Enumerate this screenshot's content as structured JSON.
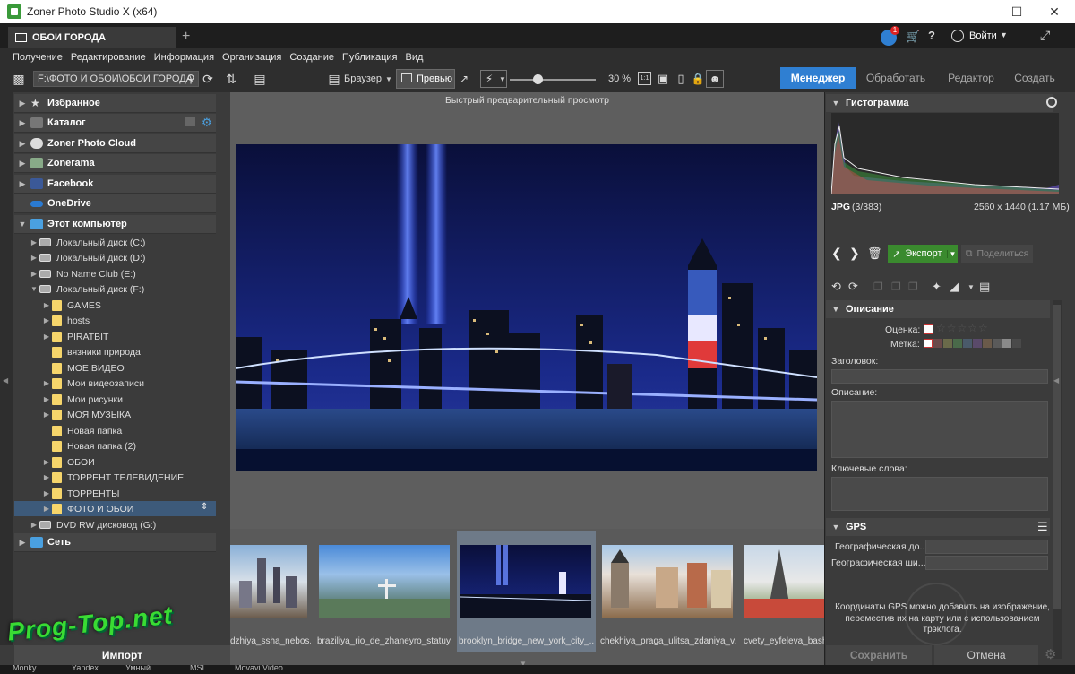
{
  "window": {
    "title": "Zoner Photo Studio X (x64)"
  },
  "tab": {
    "label": "ОБОИ ГОРОДА",
    "add": "+"
  },
  "header": {
    "login": "Войти",
    "notification_count": "1"
  },
  "menu": [
    "Получение",
    "Редактирование",
    "Информация",
    "Организация",
    "Создание",
    "Публикация",
    "Вид"
  ],
  "toolbar": {
    "path": "F:\\ФОТО И ОБОИ\\ОБОИ ГОРОДА",
    "browser_label": "Браузер",
    "preview_label": "Превью",
    "zoom": "30 %",
    "zoom_fraction": 0.32,
    "one_to_one": "1:1",
    "modes": [
      "Менеджер",
      "Обработать",
      "Редактор",
      "Создать"
    ],
    "active_mode": "Менеджер"
  },
  "tree": {
    "top": [
      {
        "label": "Избранное",
        "icon": "star-icon"
      },
      {
        "label": "Каталог",
        "icon": "catalog-icon"
      },
      {
        "label": "Zoner Photo Cloud",
        "icon": "cloud-icon"
      },
      {
        "label": "Zonerama",
        "icon": "zonerama-icon"
      },
      {
        "label": "Facebook",
        "icon": "facebook-icon"
      },
      {
        "label": "OneDrive",
        "icon": "onedrive-icon"
      },
      {
        "label": "Этот компьютер",
        "icon": "computer-icon"
      }
    ],
    "drives": [
      "Локальный диск (C:)",
      "Локальный диск (D:)",
      "No Name Club (E:)",
      "Локальный диск (F:)"
    ],
    "folders": [
      "GAMES",
      "hosts",
      "PIRATBIT",
      "вязники природа",
      "МОЕ ВИДЕО",
      "Мои видеозаписи",
      "Мои рисунки",
      "МОЯ МУЗЫКА",
      "Новая папка",
      "Новая папка (2)",
      "ОБОИ",
      "ТОРРЕНТ ТЕЛЕВИДЕНИЕ",
      "ТОРРЕНТЫ",
      "ФОТО И ОБОИ"
    ],
    "dvd": "DVD RW дисковод (G:)",
    "network": "Сеть",
    "import": "Импорт"
  },
  "watermark": "Prog-Top.net",
  "preview": {
    "label": "Быстрый предварительный просмотр"
  },
  "filmstrip": [
    "dzhiya_ssha_neboskreby",
    "braziliya_rio_de_zhaneyro_statuya",
    "brooklyn_bridge_new_york_city_",
    "chekhiya_praga_ulitsa_zdaniya_v",
    "cvety_eyfeleva_bashnya"
  ],
  "filmstrip_labels": [
    "dzhiya_ssha_nebos...",
    "braziliya_rio_de_zhaneyro_statuy...",
    "brooklyn_bridge_new_york_city_...",
    "chekhiya_praga_ulitsa_zdaniya_v...",
    "cvety_eyfeleva_bashn"
  ],
  "right": {
    "histogram_title": "Гистограмма",
    "format": "JPG",
    "index": "(3/383)",
    "dimensions": "2560 x 1440 (1.17 МБ)",
    "export": "Экспорт",
    "share": "Поделиться",
    "description_title": "Описание",
    "rating_label": "Оценка:",
    "tag_label": "Метка:",
    "headline_label": "Заголовок:",
    "description_label": "Описание:",
    "keywords_label": "Ключевые слова:",
    "gps_title": "GPS",
    "latitude_label": "Географическая до...",
    "longitude_label": "Географическая ши...",
    "gps_hint": "Координаты GPS можно добавить на изображение, переместив их на карту или с использованием трэклога.",
    "save": "Сохранить",
    "cancel": "Отмена"
  },
  "colors": {
    "accent": "#2f7fd2",
    "export_green": "#3a8a2e",
    "folder": "#f6d56b",
    "watermark": "#3adb33"
  },
  "taskbar": [
    "Monky",
    "Yandex",
    "Умный",
    "MSI",
    "Movavi Video"
  ]
}
